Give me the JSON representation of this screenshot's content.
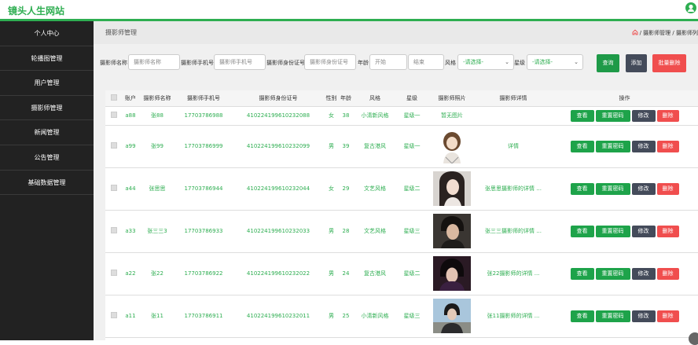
{
  "app": {
    "title": "镜头人生网站"
  },
  "sidebar": {
    "items": [
      {
        "label": "个人中心"
      },
      {
        "label": "轮播图管理"
      },
      {
        "label": "用户管理"
      },
      {
        "label": "摄影师管理"
      },
      {
        "label": "新闻管理"
      },
      {
        "label": "公告管理"
      },
      {
        "label": "基础数据管理"
      }
    ]
  },
  "page": {
    "title": "摄影师管理",
    "breadcrumb": "/ 摄影师管理 / 摄影师列"
  },
  "filters": {
    "name_label": "摄影师名称",
    "name_placeholder": "摄影师名称",
    "phone_label": "摄影师手机号",
    "phone_placeholder": "摄影师手机号",
    "idcard_label": "摄影师身份证号",
    "idcard_placeholder": "摄影师身份证号",
    "age_label": "年龄",
    "age_start_placeholder": "开始",
    "age_end_placeholder": "结束",
    "style_label": "风格",
    "style_value": "-请选择-",
    "level_label": "星级",
    "level_value": "-请选择-",
    "query_button": "查询",
    "add_button": "添加",
    "batch_delete_button": "批量删除"
  },
  "table": {
    "headers": [
      "账户",
      "摄影师名称",
      "摄影师手机号",
      "摄影师身份证号",
      "性别",
      "年龄",
      "风格",
      "星级",
      "摄影师照片",
      "摄影师详情",
      "操作"
    ],
    "actions": {
      "view": "查看",
      "reset": "重置密码",
      "edit": "修改",
      "delete": "删除"
    },
    "rows": [
      {
        "account": "a88",
        "name": "张88",
        "phone": "17703786988",
        "idcard": "410224199610232088",
        "gender": "女",
        "age": "38",
        "style": "小清新风格",
        "level": "星级一",
        "photo": "暂无图片",
        "detail": ""
      },
      {
        "account": "a99",
        "name": "张99",
        "phone": "17703786999",
        "idcard": "410224199610232099",
        "gender": "男",
        "age": "39",
        "style": "复古港风",
        "level": "星级一",
        "photo": "",
        "detail": "详情"
      },
      {
        "account": "a44",
        "name": "张思思",
        "phone": "17703786944",
        "idcard": "410224199610232044",
        "gender": "女",
        "age": "29",
        "style": "文艺风格",
        "level": "星级二",
        "photo": "",
        "detail": "张思思摄影师的详情 ..."
      },
      {
        "account": "a33",
        "name": "张三三3",
        "phone": "17703786933",
        "idcard": "410224199610232033",
        "gender": "男",
        "age": "28",
        "style": "文艺风格",
        "level": "星级三",
        "photo": "",
        "detail": "张三三摄影师的详情 ..."
      },
      {
        "account": "a22",
        "name": "张22",
        "phone": "17703786922",
        "idcard": "410224199610232022",
        "gender": "男",
        "age": "24",
        "style": "复古港风",
        "level": "星级二",
        "photo": "",
        "detail": "张22摄影师的详情 ..."
      },
      {
        "account": "a11",
        "name": "张11",
        "phone": "17703786911",
        "idcard": "410224199610232011",
        "gender": "男",
        "age": "25",
        "style": "小清新风格",
        "level": "星级三",
        "photo": "",
        "detail": "张11摄影师的详情 ..."
      }
    ]
  },
  "colors": {
    "accent": "#2eae51",
    "sidebar": "#222222",
    "danger": "#f04e4e",
    "dark_button": "#444b5a"
  },
  "icons": {
    "avatar": "user-icon",
    "home": "home-icon",
    "checkbox": "checkbox-icon"
  }
}
